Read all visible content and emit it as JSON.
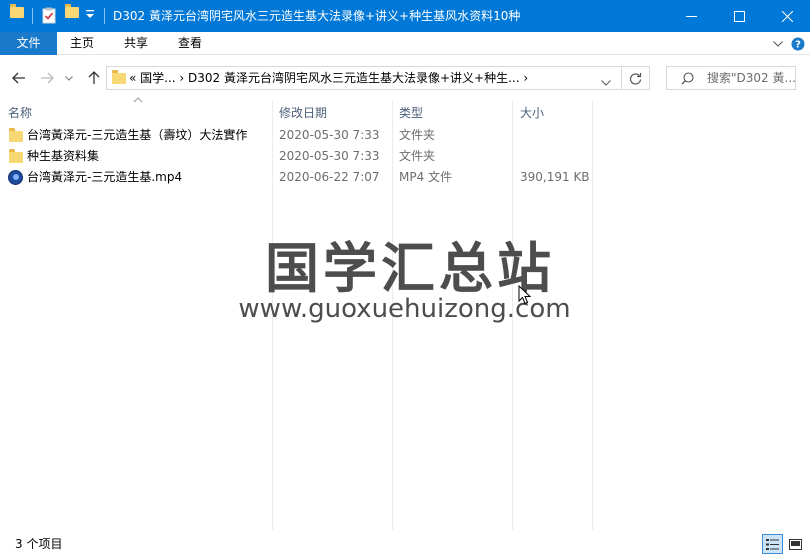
{
  "window": {
    "title": "D302 黃泽元台湾阴宅风水三元造生基大法录像+讲义+种生基风水资料10种",
    "accent_color": "#0078d7",
    "minimize_icon": "minimize-icon",
    "maximize_icon": "maximize-icon",
    "close_icon": "close-icon"
  },
  "ribbon": {
    "tabs": [
      "文件",
      "主页",
      "共享",
      "查看"
    ],
    "file_tab_color": "#1979ca"
  },
  "nav": {
    "address": "«  国学...  ›  D302 黃泽元台湾阴宅风水三元造生基大法录像+讲义+种生...  ›",
    "search_placeholder": "搜索\"D302 黃..."
  },
  "columns": {
    "name": "名称",
    "date": "修改日期",
    "type": "类型",
    "size": "大小"
  },
  "files": [
    {
      "name": "台湾黃泽元-三元造生基（壽坟）大法實作",
      "date": "2020-05-30 7:33",
      "type": "文件夹",
      "size": "",
      "icon": "folder-icon"
    },
    {
      "name": "种生基资料集",
      "date": "2020-05-30 7:33",
      "type": "文件夹",
      "size": "",
      "icon": "folder-icon"
    },
    {
      "name": "台湾黃泽元-三元造生基.mp4",
      "date": "2020-06-22 7:07",
      "type": "MP4 文件",
      "size": "390,191 KB",
      "icon": "video-file-icon"
    }
  ],
  "watermark": {
    "cn": "国学汇总站",
    "en": "www.guoxuehuizong.com"
  },
  "status": {
    "count": "3 个项目"
  }
}
